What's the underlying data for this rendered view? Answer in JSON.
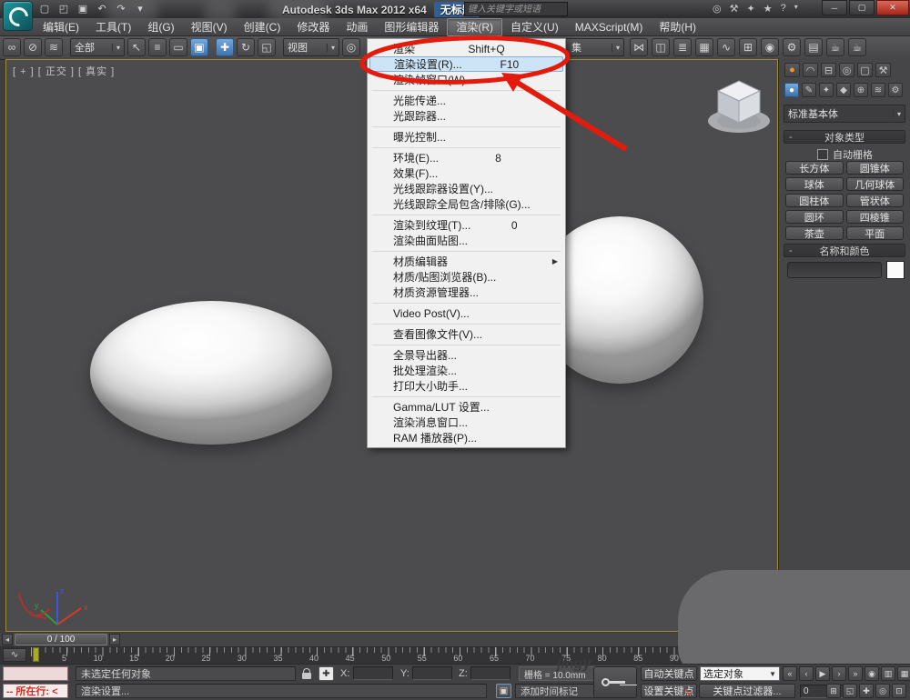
{
  "title_bar": {
    "app_title": "Autodesk 3ds Max  2012 x64",
    "doc_title": "无标题"
  },
  "infocenter": {
    "search_placeholder": "键入关键字或短语"
  },
  "menu_bar": {
    "items": [
      {
        "label": "编辑(E)"
      },
      {
        "label": "工具(T)"
      },
      {
        "label": "组(G)"
      },
      {
        "label": "视图(V)"
      },
      {
        "label": "创建(C)"
      },
      {
        "label": "修改器"
      },
      {
        "label": "动画"
      },
      {
        "label": "图形编辑器"
      },
      {
        "label": "渲染(R)",
        "active": true
      },
      {
        "label": "自定义(U)"
      },
      {
        "label": "MAXScript(M)"
      },
      {
        "label": "帮助(H)"
      }
    ]
  },
  "toolbar": {
    "filter_dropdown": "全部",
    "coord_dropdown": "视图",
    "selset_dropdown": "集"
  },
  "render_menu": {
    "items": [
      {
        "label": "渲染",
        "shortcut": "Shift+Q"
      },
      {
        "label": "渲染设置(R)...",
        "shortcut": "F10",
        "highlighted": true
      },
      {
        "label": "渲染帧窗口(W)"
      },
      {
        "sep": true
      },
      {
        "label": "光能传递..."
      },
      {
        "label": "光跟踪器..."
      },
      {
        "sep": true
      },
      {
        "label": "曝光控制..."
      },
      {
        "sep": true
      },
      {
        "label": "环境(E)...",
        "shortcut": "8"
      },
      {
        "label": "效果(F)..."
      },
      {
        "label": "光线跟踪器设置(Y)..."
      },
      {
        "label": "光线跟踪全局包含/排除(G)..."
      },
      {
        "sep": true
      },
      {
        "label": "渲染到纹理(T)...",
        "shortcut": "0"
      },
      {
        "label": "渲染曲面贴图..."
      },
      {
        "sep": true
      },
      {
        "label": "材质编辑器",
        "arrow": "▶"
      },
      {
        "label": "材质/贴图浏览器(B)..."
      },
      {
        "label": "材质资源管理器..."
      },
      {
        "sep": true
      },
      {
        "label": "Video Post(V)..."
      },
      {
        "sep": true
      },
      {
        "label": "查看图像文件(V)..."
      },
      {
        "sep": true
      },
      {
        "label": "全景导出器..."
      },
      {
        "label": "批处理渲染..."
      },
      {
        "label": "打印大小助手..."
      },
      {
        "sep": true
      },
      {
        "label": "Gamma/LUT 设置..."
      },
      {
        "label": "渲染消息窗口..."
      },
      {
        "label": "RAM 播放器(P)..."
      }
    ]
  },
  "viewport": {
    "label": "[ + ] [ 正交 ] [ 真实 ]",
    "axis": {
      "x": "x",
      "y": "y",
      "z": "z"
    }
  },
  "command_panel": {
    "primitive_dropdown": "标准基本体",
    "rollout_object_type": "对象类型",
    "collapse_marker": "-",
    "autogrid_label": "自动栅格",
    "object_buttons": [
      "长方体",
      "圆锥体",
      "球体",
      "几何球体",
      "圆柱体",
      "管状体",
      "圆环",
      "四棱锥",
      "茶壶",
      "平面"
    ],
    "rollout_name_color": "名称和颜色"
  },
  "timeline": {
    "slider_label": "0 / 100",
    "tick_labels": [
      "5",
      "10",
      "15",
      "20",
      "25",
      "30",
      "35",
      "40",
      "45",
      "50",
      "55",
      "60",
      "65",
      "70",
      "75",
      "80",
      "85",
      "90"
    ]
  },
  "status_bar": {
    "listener_red": "-- 所在行:  <",
    "selection_status": "未选定任何对象",
    "prompt": "渲染设置...",
    "x_label": "X:",
    "y_label": "Y:",
    "z_label": "Z:",
    "grid": "栅格 = 10.0mm",
    "add_time_tag": "添加时间标记",
    "auto_key": "自动关键点",
    "set_key": "设置关键点",
    "selected_combo": "选定对象",
    "key_filters": "关键点过滤器...",
    "frame_field": "0"
  },
  "watermark": "jingy",
  "transport_row1": [
    {
      "name": "go-to-start-icon",
      "glyph": "«"
    },
    {
      "name": "previous-key-icon",
      "glyph": "‹"
    },
    {
      "name": "play-icon",
      "glyph": "▶"
    },
    {
      "name": "next-key-icon",
      "glyph": "›"
    },
    {
      "name": "go-to-end-icon",
      "glyph": "»"
    },
    {
      "name": "key-mode-toggle-icon",
      "glyph": "◉"
    },
    {
      "name": "track-view-icon",
      "glyph": "▥"
    },
    {
      "name": "zoom-region-icon",
      "glyph": "▦"
    },
    {
      "name": "fov-icon",
      "glyph": "◔"
    }
  ],
  "transport_row2": [
    {
      "name": "time-config-icon",
      "glyph": "⊞"
    },
    {
      "name": "zoom-extents-icon",
      "glyph": "◱"
    },
    {
      "name": "pan-viewport-icon",
      "glyph": "✚"
    },
    {
      "name": "orbit-viewport-icon",
      "glyph": "◎"
    },
    {
      "name": "maximize-viewport-toggle-icon",
      "glyph": "⊡"
    }
  ],
  "icons": {
    "new": "▢",
    "open": "◰",
    "save": "▣",
    "undo": "↶",
    "redo": "↷",
    "dd_arrow": "▾",
    "collapse": "▸",
    "ic_search": "◎",
    "ic_wrench": "⚒",
    "ic_comm": "✦",
    "ic_star": "★",
    "ic_help": "?",
    "win_min": "─",
    "win_restore": "▢",
    "win_close": "✕",
    "link": "∞",
    "unlink": "⊘",
    "bind_spacewarp": "≋",
    "select_object": "↖",
    "select_by_name": "≡",
    "select_region": "▭",
    "window_crossing": "▣",
    "move": "✚",
    "rotate": "↻",
    "scale": "◱",
    "use_center": "◎",
    "mirror": "⋈",
    "align": "◫",
    "layer_manager": "≣",
    "graphite": "▦",
    "curve_editor": "∿",
    "schematic_view": "⊞",
    "material_editor": "◉",
    "render_setup": "⚙",
    "rendered_frame": "▤",
    "render_production": "☕",
    "render_iterative": "☕",
    "tab_create": "●",
    "tab_modify": "◠",
    "tab_hierarchy": "⊟",
    "tab_motion": "◎",
    "tab_display": "▢",
    "tab_utilities": "⚒",
    "cat_geometry": "●",
    "cat_shapes": "✎",
    "cat_lights": "✦",
    "cat_cameras": "◆",
    "cat_helpers": "⊕",
    "cat_spacewarps": "≋",
    "cat_systems": "⚙",
    "minicurve": "∿",
    "slider_prev": "◂",
    "slider_next": "▸",
    "isolate": "▣",
    "abs_offset": "✚",
    "red_curve": "∿",
    "combo_arrow": "▼",
    "spin_up": "▴",
    "spin_down": "▾"
  }
}
